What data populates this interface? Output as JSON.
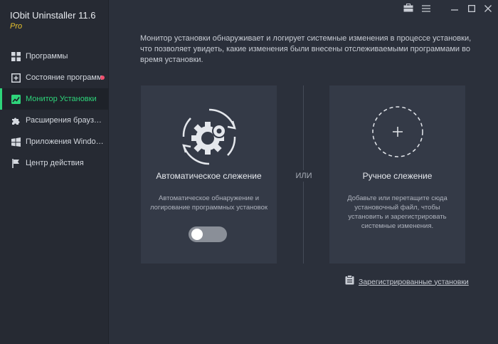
{
  "app": {
    "title": "IObit Uninstaller 11.6",
    "edition": "Pro"
  },
  "sidebar": {
    "items": [
      {
        "label": "Программы",
        "icon": "grid-icon"
      },
      {
        "label": "Состояние программ",
        "icon": "add-box-icon",
        "badge": true
      },
      {
        "label": "Монитор Установки",
        "icon": "chart-icon",
        "active": true
      },
      {
        "label": "Расширения браузера",
        "icon": "puzzle-icon"
      },
      {
        "label": "Приложения Windows",
        "icon": "windows-icon"
      },
      {
        "label": "Центр действия",
        "icon": "flag-icon"
      }
    ]
  },
  "main": {
    "description": "Монитор установки обнаруживает и логирует системные изменения в процессе установки, что позволяет увидеть, какие изменения были внесены отслеживаемыми программами во время установки.",
    "or_label": "ИЛИ",
    "auto": {
      "title": "Автоматическое слежение",
      "text": "Автоматическое обнаружение и логирование программных установок",
      "toggle_on": false
    },
    "manual": {
      "title": "Ручное слежение",
      "text": "Добавьте или перетащите сюда установочный файл, чтобы установить и зарегистрировать системные изменения."
    },
    "registered_link": "Зарегистрированные установки"
  },
  "colors": {
    "accent": "#2ed47a",
    "badge": "#f0506e",
    "edition": "#e6c22e"
  }
}
